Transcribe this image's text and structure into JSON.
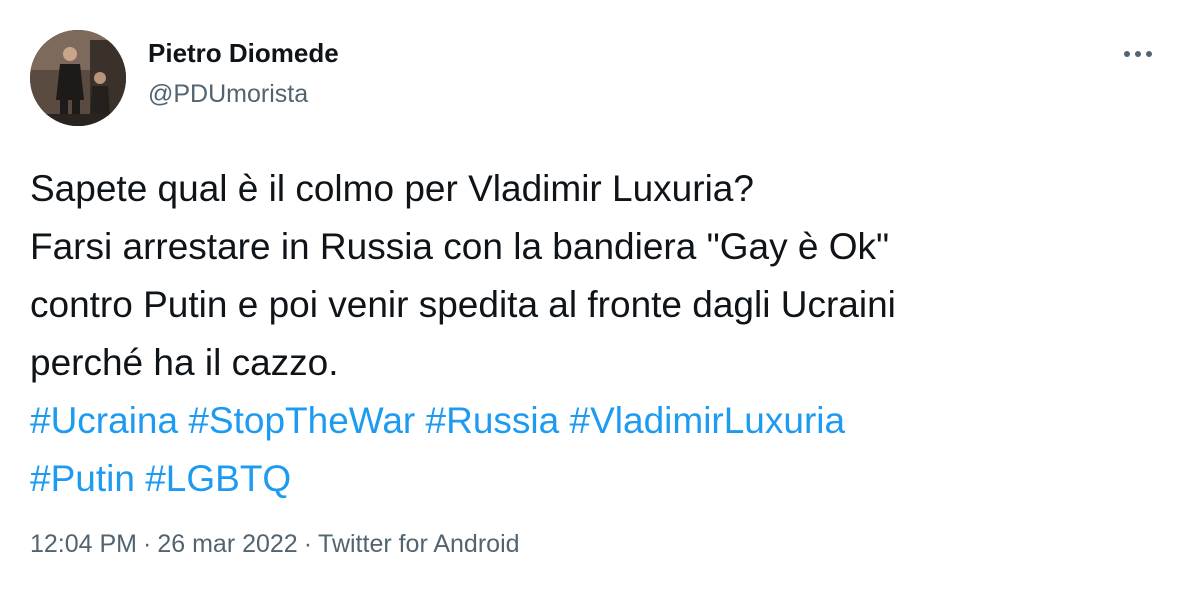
{
  "author": {
    "display_name": "Pietro Diomede",
    "handle": "@PDUmorista"
  },
  "more_icon": "more-horizontal-icon",
  "tweet": {
    "lines": [
      "Sapete qual è il colmo per Vladimir Luxuria?",
      "Farsi arrestare in Russia con la bandiera \"Gay è Ok\"",
      "contro Putin e poi venir spedita al fronte dagli Ucraini",
      "perché ha il cazzo."
    ],
    "hashtags": [
      "#Ucraina",
      "#StopTheWar",
      "#Russia",
      "#VladimirLuxuria",
      "#Putin",
      "#LGBTQ"
    ]
  },
  "meta": {
    "time": "12:04 PM",
    "date": "26 mar 2022",
    "source": "Twitter for Android",
    "separator": "·"
  },
  "colors": {
    "text": "#0f1419",
    "secondary": "#536471",
    "link": "#1d9bf0"
  }
}
